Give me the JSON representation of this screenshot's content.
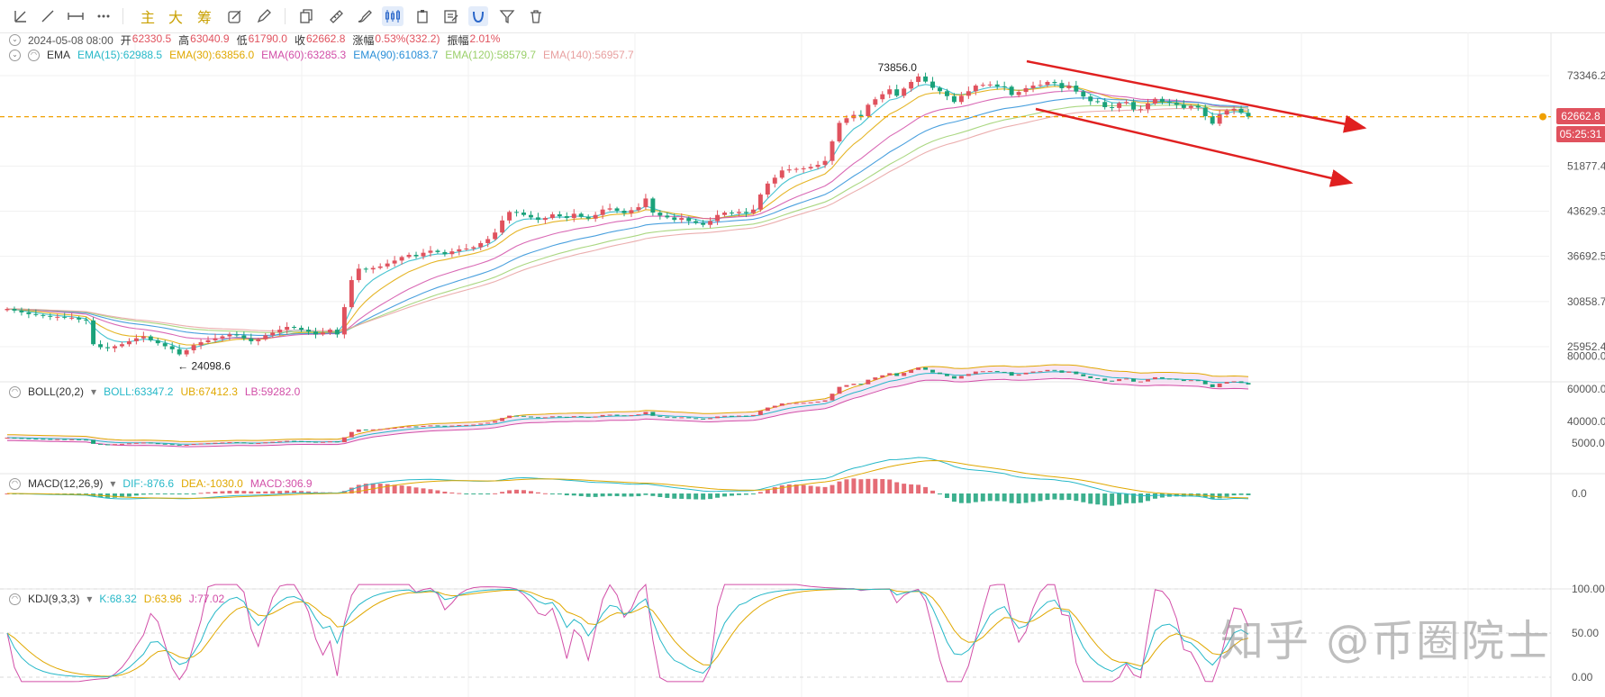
{
  "toolbar": {
    "tools": [
      "trend-line-tool",
      "ray-line-tool",
      "horizontal-ray-tool",
      "more-lines-tool"
    ],
    "zh_buttons": [
      "主",
      "大",
      "筹"
    ],
    "icons": [
      "drawing-tools-icon",
      "pen-edit-icon",
      "copy-icon",
      "ruler-icon",
      "brush-icon",
      "candle-style-icon",
      "clipboard-icon",
      "note-icon",
      "magnet-icon",
      "filter-icon",
      "trash-icon"
    ]
  },
  "header": {
    "date": "2024-05-08 08:00",
    "open_label": "开",
    "open": "62330.5",
    "high_label": "高",
    "high": "63040.9",
    "low_label": "低",
    "low": "61790.0",
    "close_label": "收",
    "close": "62662.8",
    "change_label": "涨幅",
    "change": "0.53%(332.2)",
    "amp_label": "振幅",
    "amp": "2.01%"
  },
  "ema": {
    "name": "EMA",
    "items": [
      {
        "label": "EMA(15):62988.5",
        "color": "#26b8c8"
      },
      {
        "label": "EMA(30):63856.0",
        "color": "#e0a800"
      },
      {
        "label": "EMA(60):63285.3",
        "color": "#d24fa8"
      },
      {
        "label": "EMA(90):61083.7",
        "color": "#2a8fd8"
      },
      {
        "label": "EMA(120):58579.7",
        "color": "#9bd06b"
      },
      {
        "label": "EMA(140):56957.7",
        "color": "#e8a0a0"
      }
    ]
  },
  "boll": {
    "name": "BOLL(20,2)",
    "items": [
      {
        "label": "BOLL:63347.2",
        "color": "#26b8c8"
      },
      {
        "label": "UB:67412.3",
        "color": "#e0a800"
      },
      {
        "label": "LB:59282.0",
        "color": "#d24fa8"
      }
    ]
  },
  "macd": {
    "name": "MACD(12,26,9)",
    "items": [
      {
        "label": "DIF:-876.6",
        "color": "#26b8c8"
      },
      {
        "label": "DEA:-1030.0",
        "color": "#e0a800"
      },
      {
        "label": "MACD:306.9",
        "color": "#d24fa8"
      }
    ]
  },
  "kdj": {
    "name": "KDJ(9,3,3)",
    "items": [
      {
        "label": "K:68.32",
        "color": "#26b8c8"
      },
      {
        "label": "D:63.96",
        "color": "#e0a800"
      },
      {
        "label": "J:77.02",
        "color": "#d24fa8"
      }
    ]
  },
  "price_tag": "62662.8",
  "countdown_tag": "05:25:31",
  "annotations": {
    "high_marker": "73856.0",
    "low_marker": "← 24098.6"
  },
  "watermark": "知乎 @币圈院士",
  "colors": {
    "up": "#e0525e",
    "down": "#1aa27a",
    "arrow": "#e02020",
    "price_line": "#f0a000"
  },
  "chart_data": [
    {
      "type": "candlestick",
      "title": "",
      "y_ticks": [
        73346.2,
        62662.8,
        51877.4,
        43629.3,
        36692.5,
        30858.7,
        25952.4
      ],
      "y_tick_labels": [
        "73346.2",
        "62662.8",
        "51877.4",
        "43629.3",
        "36692.5",
        "30858.7",
        "25952.4"
      ],
      "ylim": [
        24000,
        76000
      ],
      "scale": "log",
      "current_price": 62662.8,
      "high_marker": 73856.0,
      "low_marker": 24098.6,
      "closes": [
        30000,
        29800,
        29600,
        29400,
        29300,
        29200,
        29100,
        29100,
        29000,
        29000,
        28800,
        28700,
        26200,
        25900,
        25800,
        26000,
        26200,
        26500,
        26800,
        27000,
        26600,
        26300,
        26000,
        25700,
        25200,
        25600,
        26100,
        26400,
        26600,
        26800,
        27000,
        27200,
        27100,
        26800,
        26500,
        26700,
        27100,
        27400,
        27700,
        28000,
        27900,
        27700,
        27500,
        27200,
        27400,
        27700,
        27200,
        30200,
        33500,
        35000,
        34900,
        35100,
        35300,
        35700,
        36100,
        36600,
        36900,
        36700,
        37200,
        37500,
        37300,
        37000,
        37400,
        37700,
        37800,
        38000,
        38600,
        39200,
        40200,
        42100,
        43500,
        43400,
        43000,
        42600,
        42200,
        42500,
        43100,
        42800,
        42500,
        43200,
        42700,
        42400,
        43000,
        43900,
        44100,
        43700,
        43300,
        43800,
        44300,
        45800,
        43400,
        42900,
        42600,
        42200,
        42500,
        42000,
        41700,
        41400,
        42000,
        43000,
        43400,
        43300,
        43500,
        43300,
        43900,
        46500,
        48500,
        49600,
        51000,
        51200,
        51300,
        51400,
        51700,
        52100,
        52900,
        57000,
        61200,
        62300,
        63100,
        62800,
        65600,
        67000,
        68300,
        69600,
        67900,
        69800,
        71600,
        73100,
        71700,
        70000,
        69100,
        67800,
        66300,
        67900,
        69100,
        70600,
        70800,
        70900,
        70400,
        70300,
        68100,
        68900,
        69900,
        70600,
        70800,
        71600,
        71300,
        69900,
        70600,
        69000,
        67700,
        66500,
        66300,
        65000,
        64800,
        66000,
        66300,
        64400,
        64500,
        65900,
        67100,
        66300,
        66100,
        65600,
        64800,
        65300,
        64900,
        62800,
        61000,
        63200,
        64200,
        64600,
        63600,
        62663
      ],
      "ema_series": [
        "EMA(15)",
        "EMA(30)",
        "EMA(60)",
        "EMA(90)",
        "EMA(120)",
        "EMA(140)"
      ]
    },
    {
      "type": "line",
      "name": "BOLL(20,2)",
      "y_tick_labels": [
        "80000.0",
        "60000.0",
        "40000.0"
      ],
      "series": [
        "BOLL",
        "UB",
        "LB"
      ]
    },
    {
      "type": "bar",
      "name": "MACD(12,26,9)",
      "y_tick_labels": [
        "5000.0",
        "0.0"
      ],
      "series": [
        "DIF",
        "DEA",
        "MACD"
      ]
    },
    {
      "type": "line",
      "name": "KDJ(9,3,3)",
      "y_tick_labels": [
        "100.00",
        "50.00",
        "0.00"
      ],
      "ylim": [
        0,
        100
      ],
      "series": [
        "K",
        "D",
        "J"
      ]
    }
  ]
}
